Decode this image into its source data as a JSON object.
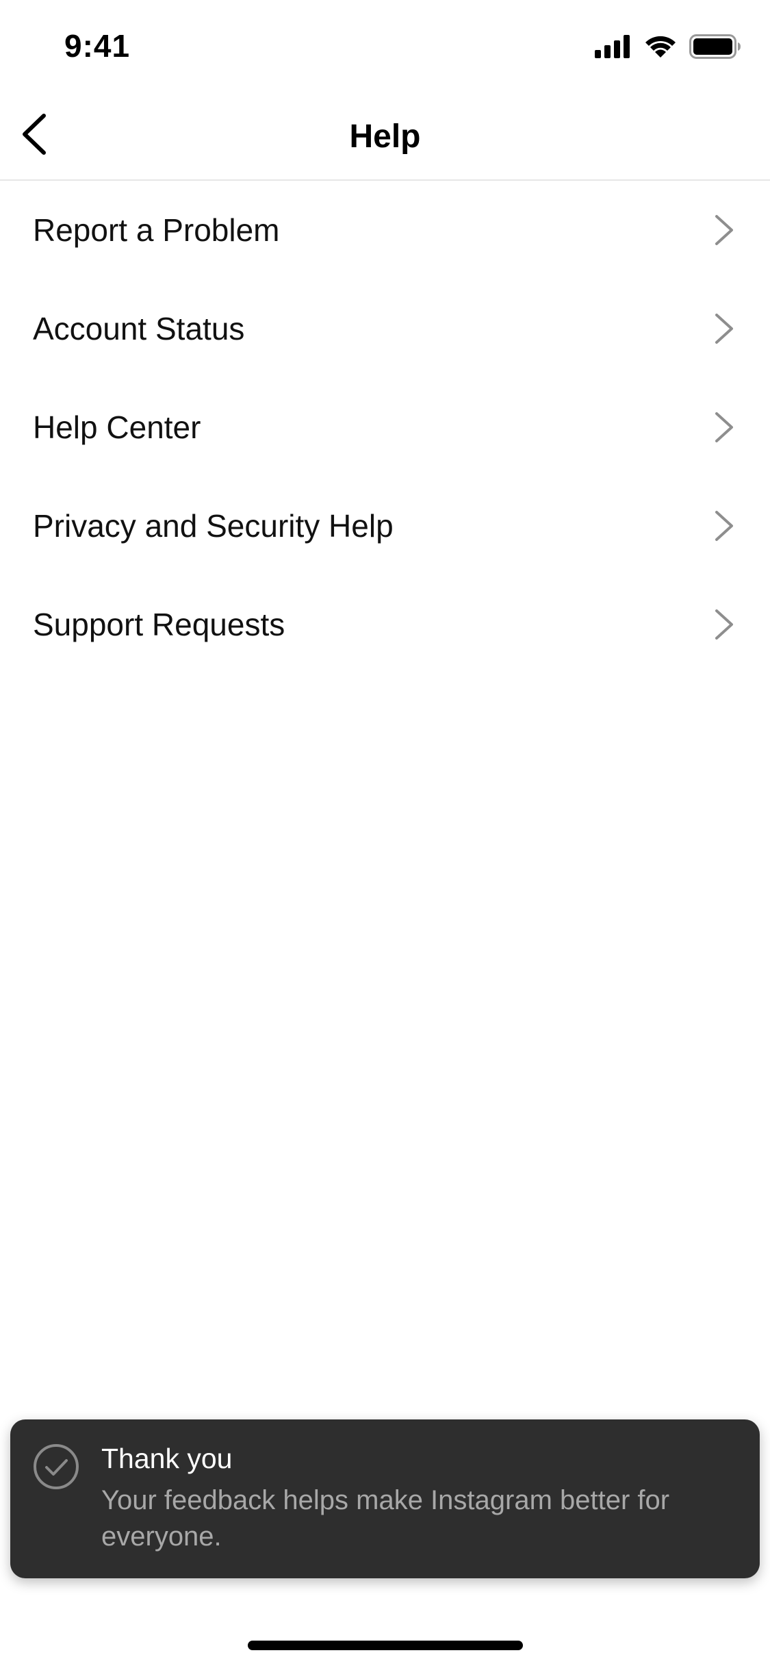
{
  "status_bar": {
    "time": "9:41"
  },
  "header": {
    "title": "Help",
    "back_icon": "chevron-left-icon"
  },
  "menu": {
    "items": [
      {
        "label": "Report a Problem"
      },
      {
        "label": "Account Status"
      },
      {
        "label": "Help Center"
      },
      {
        "label": "Privacy and Security Help"
      },
      {
        "label": "Support Requests"
      }
    ]
  },
  "toast": {
    "icon": "check-circle-icon",
    "title": "Thank you",
    "message": "Your feedback helps make Instagram better for everyone."
  },
  "colors": {
    "toast_background": "#2e2e2e",
    "toast_title": "#ffffff",
    "toast_message": "#a8a8a8",
    "chevron": "#8e8e8e",
    "divider": "#e6e6e6"
  }
}
